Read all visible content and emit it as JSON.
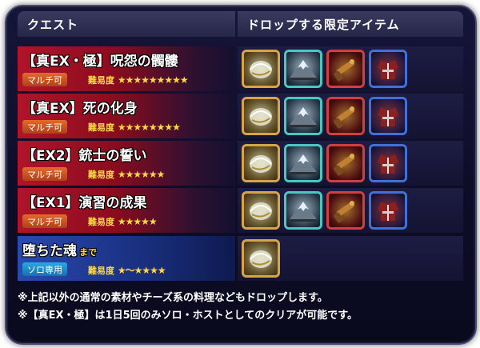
{
  "header": {
    "quest": "クエスト",
    "drops": "ドロップする限定アイテム"
  },
  "quests": [
    {
      "title": "【真EX・極】呪怨の髑髏",
      "suffix": "",
      "badge": "マルチ可",
      "badge_type": "multi",
      "diff_label": "難易度",
      "stars": "★★★★★★★★★",
      "bg": "red",
      "items": [
        "gold-orb",
        "mountain",
        "red-weapon",
        "blue-armor"
      ]
    },
    {
      "title": "【真EX】死の化身",
      "suffix": "",
      "badge": "マルチ可",
      "badge_type": "multi",
      "diff_label": "難易度",
      "stars": "★★★★★★★★",
      "bg": "red",
      "items": [
        "gold-orb",
        "mountain",
        "red-weapon",
        "blue-armor"
      ]
    },
    {
      "title": "【EX2】銃士の誓い",
      "suffix": "",
      "badge": "マルチ可",
      "badge_type": "multi",
      "diff_label": "難易度",
      "stars": "★★★★★★",
      "bg": "red",
      "items": [
        "gold-orb",
        "mountain",
        "red-weapon",
        "blue-armor"
      ]
    },
    {
      "title": "【EX1】演習の成果",
      "suffix": "",
      "badge": "マルチ可",
      "badge_type": "multi",
      "diff_label": "難易度",
      "stars": "★★★★★",
      "bg": "red",
      "items": [
        "gold-orb",
        "mountain",
        "red-weapon",
        "blue-armor"
      ]
    },
    {
      "title": "堕ちた魂",
      "suffix": "まで",
      "badge": "ソロ専用",
      "badge_type": "solo",
      "diff_label": "難易度",
      "stars": "★～★★★★",
      "bg": "blue",
      "items": [
        "gold-orb"
      ]
    }
  ],
  "footer": [
    "※上記以外の通常の素材やチーズ系の料理などもドロップします。",
    "※【真EX・極】は1日5回のみソロ・ホストとしてのクリアが可能です。"
  ],
  "colors": {
    "red_bg": "#9a1020",
    "blue_bg": "#1a3a90",
    "star": "#ffd84a"
  }
}
